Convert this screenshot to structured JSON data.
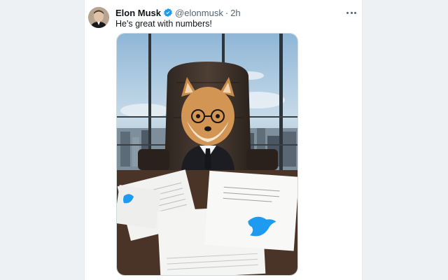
{
  "tweet": {
    "author_name": "Elon Musk",
    "author_handle": "@elonmusk",
    "separator": "·",
    "timestamp": "2h",
    "text": "He's great with numbers!",
    "verified": true
  },
  "icons": {
    "verified": "verified-badge-icon",
    "more": "more-options-icon",
    "paper_logo": "twitter-bird-icon"
  },
  "colors": {
    "accent": "#1d9bf0",
    "text_primary": "#0f1419",
    "text_secondary": "#536471"
  }
}
